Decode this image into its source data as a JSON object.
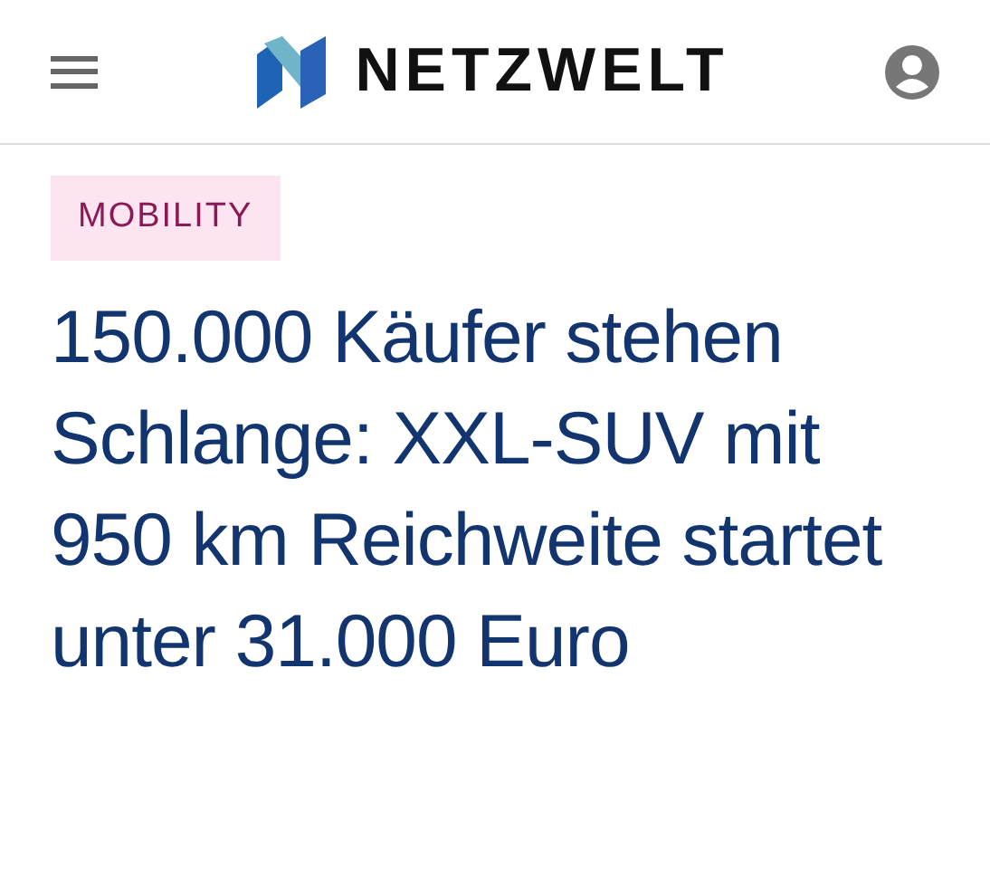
{
  "header": {
    "logo_text": "NETZWELT"
  },
  "category": "MOBILITY",
  "headline": "150.000 Käufer stehen Schlange: XXL-SUV mit 950 km Reichweite startet unter 31.000 Euro"
}
